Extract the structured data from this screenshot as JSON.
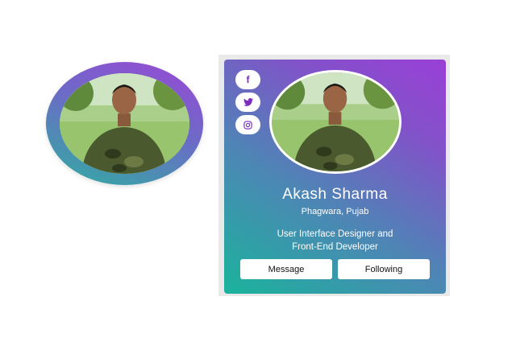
{
  "profile": {
    "name": "Akash Sharma",
    "location": "Phagwara, Pujab",
    "bio_line1": "User Interface Designer and",
    "bio_line2": "Front-End Developer"
  },
  "social": {
    "facebook_glyph": "f",
    "twitter_icon": "twitter-icon",
    "instagram_icon": "instagram-icon"
  },
  "actions": {
    "message_label": "Message",
    "following_label": "Following"
  },
  "colors": {
    "gradient_start": "#1bb39c",
    "gradient_mid": "#4d86b5",
    "gradient_end": "#9a3fd7",
    "icon_color": "#7b2cbf"
  }
}
